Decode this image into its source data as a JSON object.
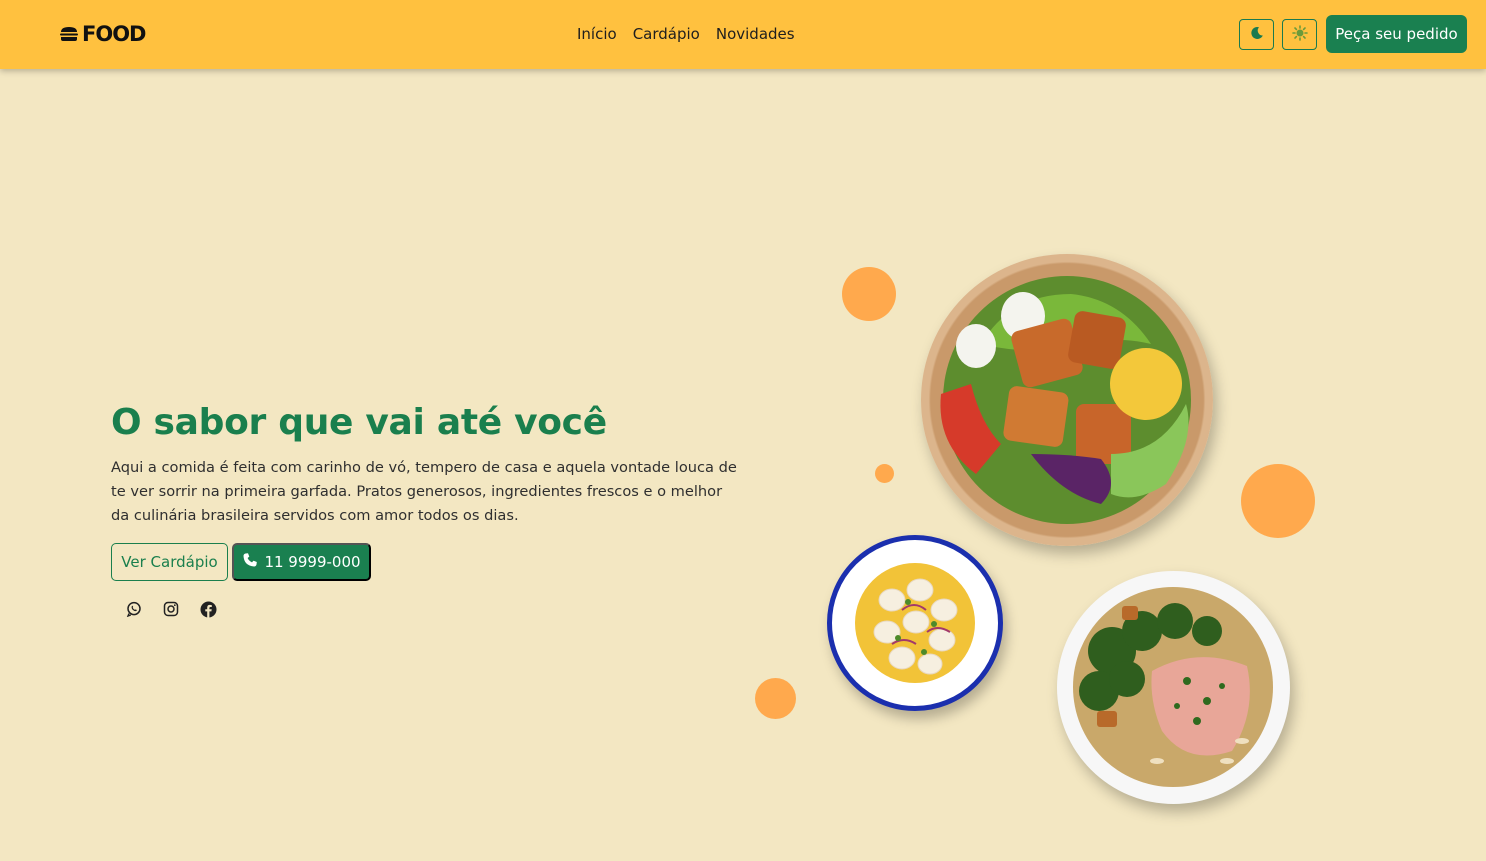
{
  "brand": {
    "name": "FOOD",
    "icon": "burger-icon"
  },
  "nav": {
    "items": [
      {
        "label": "Início"
      },
      {
        "label": "Cardápio"
      },
      {
        "label": "Novidades"
      }
    ]
  },
  "header_actions": {
    "dark_icon": "moon-icon",
    "light_icon": "sun-icon",
    "order_label": "Peça seu pedido"
  },
  "hero": {
    "title": "O sabor que vai até você",
    "description": "Aqui a comida é feita com carinho de vó, tempero de casa e aquela vontade louca de te ver sorrir na primeira garfada. Pratos generosos, ingredientes frescos e o melhor da culinária brasileira servidos com amor todos os dias.",
    "menu_button": "Ver Cardápio",
    "phone_button": "11 9999-000",
    "social": [
      {
        "icon": "whatsapp-icon"
      },
      {
        "icon": "instagram-icon"
      },
      {
        "icon": "facebook-icon"
      }
    ]
  },
  "colors": {
    "header": "#ffc13f",
    "background": "#f3e7c2",
    "primary_green": "#1a8050",
    "accent_orange": "#ffa94d"
  }
}
